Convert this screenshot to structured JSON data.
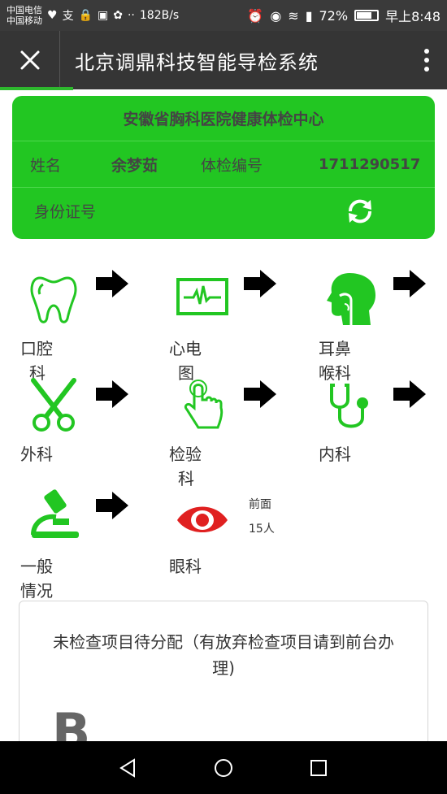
{
  "status_bar": {
    "carrier1": "中国电信",
    "carrier2": "中国移动",
    "speed": "182B/s",
    "battery": "72%",
    "time": "早上8:48"
  },
  "header": {
    "title": "北京调鼎科技智能导检系统"
  },
  "info_card": {
    "hospital": "安徽省胸科医院健康体检中心",
    "name_label": "姓名",
    "name_value": "余梦茹",
    "exam_id_label": "体检编号",
    "exam_id_value": "1711290517",
    "id_card_label": "身份证号"
  },
  "departments": [
    {
      "line1": "口腔",
      "line2": "科",
      "icon": "tooth-icon"
    },
    {
      "line1": "心电",
      "line2": "图",
      "icon": "ecg-monitor-icon"
    },
    {
      "line1": "耳鼻",
      "line2": "喉科",
      "icon": "ent-head-icon"
    },
    {
      "line1": "外科",
      "line2": "",
      "icon": "scissors-icon"
    },
    {
      "line1": "检验",
      "line2": "科",
      "icon": "finger-tap-icon"
    },
    {
      "line1": "内科",
      "line2": "",
      "icon": "stethoscope-icon"
    },
    {
      "line1": "一般",
      "line2": "情况",
      "icon": "microscope-icon"
    },
    {
      "line1": "眼科",
      "line2": "",
      "icon": "eye-icon"
    }
  ],
  "queue": {
    "label": "前面",
    "count": "15人"
  },
  "notice": {
    "text": "未检查项目待分配（有放弃检查项目请到前台办理)",
    "barcode_letter": "B"
  },
  "colors": {
    "accent": "#22c622",
    "eye": "#e02020",
    "header": "#353535"
  }
}
